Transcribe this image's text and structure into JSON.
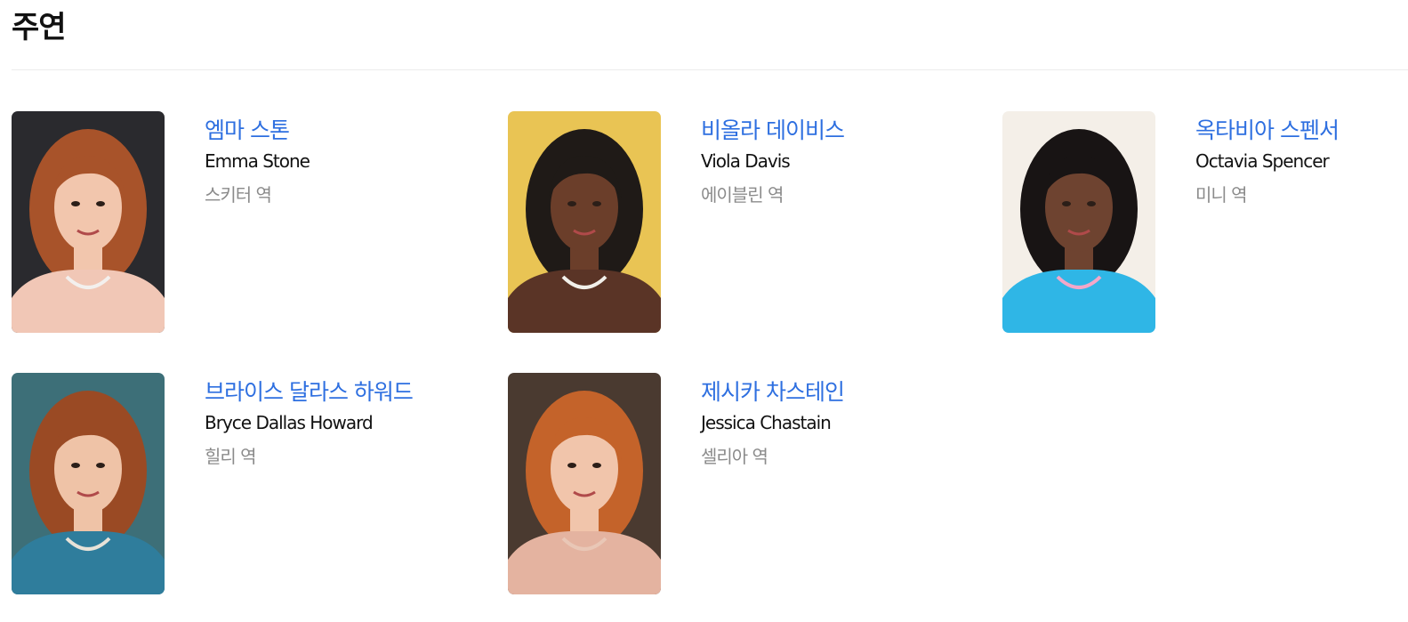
{
  "section": {
    "title": "주연"
  },
  "cast": [
    {
      "name_ko": "엠마 스톤",
      "name_en": "Emma Stone",
      "role": "스키터 역",
      "photo": {
        "bg": "#2a2a2e",
        "hair": "#a8532a",
        "skin": "#f2c6ad",
        "clothing": "#f1c7b6",
        "accent": "#f3f0ee"
      }
    },
    {
      "name_ko": "비올라 데이비스",
      "name_en": "Viola Davis",
      "role": "에이블린 역",
      "photo": {
        "bg": "#e9c454",
        "hair": "#1f1a17",
        "skin": "#6b3e2a",
        "clothing": "#5a3426",
        "accent": "#f2f0ea"
      }
    },
    {
      "name_ko": "옥타비아 스펜서",
      "name_en": "Octavia Spencer",
      "role": "미니 역",
      "photo": {
        "bg": "#f4efe8",
        "hair": "#181414",
        "skin": "#6e4330",
        "clothing": "#2fb6e6",
        "accent": "#f4a7c9"
      }
    },
    {
      "name_ko": "브라이스 달라스 하워드",
      "name_en": "Bryce Dallas Howard",
      "role": "힐리 역",
      "photo": {
        "bg": "#3d6f78",
        "hair": "#9a4a24",
        "skin": "#efc3a7",
        "clothing": "#2f7d9c",
        "accent": "#e7e2d8"
      }
    },
    {
      "name_ko": "제시카 차스테인",
      "name_en": "Jessica Chastain",
      "role": "셀리아 역",
      "photo": {
        "bg": "#4a3a30",
        "hair": "#c4632a",
        "skin": "#f1c5ab",
        "clothing": "#e4b3a0",
        "accent": "#e9c7b6"
      }
    }
  ]
}
